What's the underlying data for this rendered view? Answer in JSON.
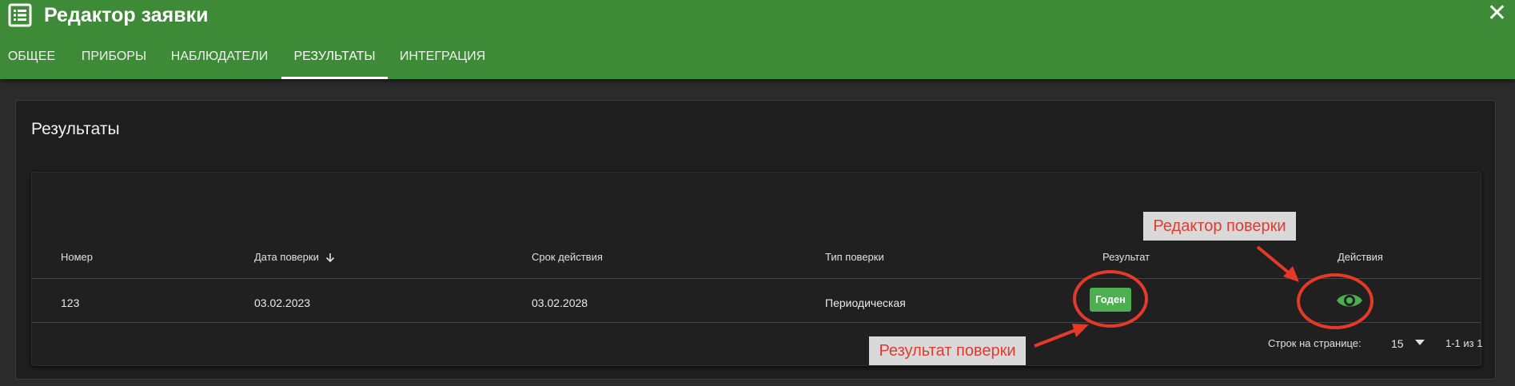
{
  "header": {
    "title": "Редактор заявки",
    "tabs": [
      {
        "label": "ОБЩЕЕ"
      },
      {
        "label": "ПРИБОРЫ"
      },
      {
        "label": "НАБЛЮДАТЕЛИ"
      },
      {
        "label": "РЕЗУЛЬТАТЫ"
      },
      {
        "label": "ИНТЕГРАЦИЯ"
      }
    ],
    "active_tab": "РЕЗУЛЬТАТЫ",
    "icons": {
      "app": "list-icon",
      "close": "close-icon"
    }
  },
  "panel": {
    "title": "Результаты",
    "table": {
      "columns": [
        "Номер",
        "Дата поверки",
        "Срок действия",
        "Тип поверки",
        "Результат",
        "Действия"
      ],
      "sorted_column": "Дата поверки",
      "rows": [
        {
          "number": "123",
          "date": "03.02.2023",
          "expiry": "03.02.2028",
          "type": "Периодическая",
          "result": "Годен"
        }
      ],
      "footer": {
        "rows_per_page_label": "Строк на странице:",
        "rows_per_page": "15",
        "range": "1-1 из 1"
      }
    }
  },
  "annotations": {
    "result_callout": "Результат поверки",
    "editor_callout": "Редактор поверки"
  },
  "colors": {
    "header": "#3d8b37",
    "badge": "#4caf50",
    "eye_icon": "#4caf50",
    "annotation": "#e53929"
  }
}
